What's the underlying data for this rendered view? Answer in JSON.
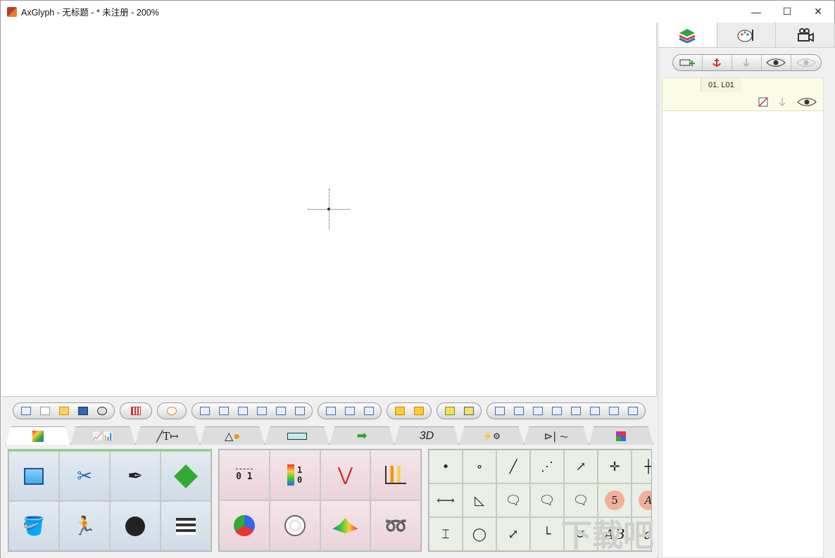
{
  "window": {
    "title": "AxGlyph - 无标题 - * 未注册 - 200%",
    "minimize": "—",
    "maximize": "☐",
    "close": "✕"
  },
  "side_panel": {
    "tabs": [
      "layers-icon",
      "palette-icon",
      "camera-icon"
    ],
    "layer": {
      "name": "01. L01"
    }
  },
  "toolbar_groups": [
    6,
    1,
    1,
    6,
    3,
    2,
    2,
    8
  ],
  "palette_tabs": [
    "image",
    "chart",
    "line-text-dim",
    "shapes",
    "flow",
    "arrow",
    "3D",
    "electric",
    "circuit",
    "grid"
  ],
  "palette_tab_labels": {
    "tab3": "3D"
  },
  "pane2": {
    "axis_label": "0 1",
    "colorbar_label": "1\n0"
  },
  "pane3": {
    "symbols": [
      "•",
      "∘",
      "╱",
      "⋰",
      "↗",
      "✛",
      "┼",
      "⟷",
      "◺",
      "🗨",
      "🗨",
      "🗨",
      "5",
      "A",
      "⌶",
      "◯",
      "⤢",
      "└",
      "↺",
      "AB",
      "α"
    ]
  },
  "watermark": "下载吧"
}
